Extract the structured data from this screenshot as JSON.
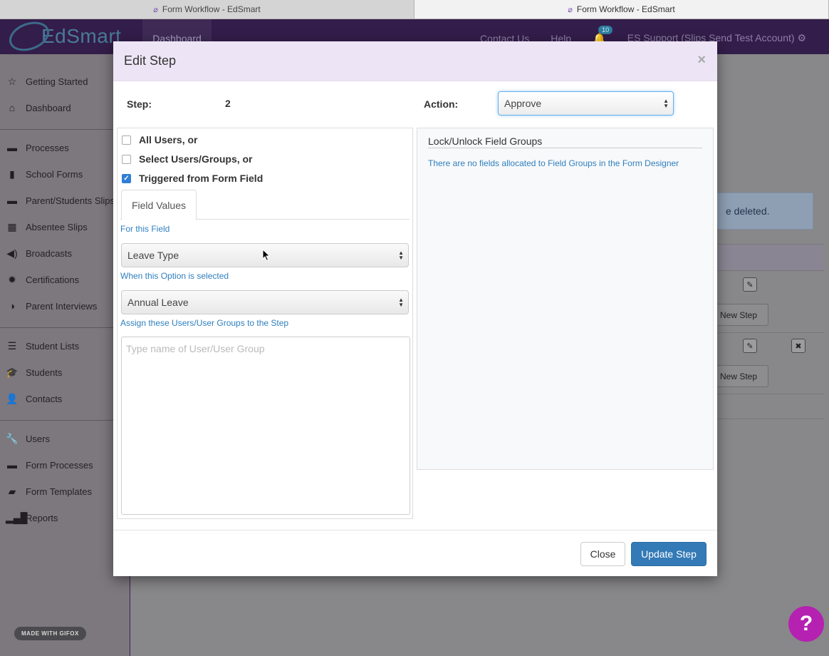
{
  "browser": {
    "tabs": [
      {
        "title": "Form Workflow - EdSmart",
        "active": false
      },
      {
        "title": "Form Workflow - EdSmart",
        "active": true
      }
    ]
  },
  "header": {
    "logo_text": "EdSmart",
    "nav_dashboard": "Dashboard",
    "contact": "Contact Us",
    "help": "Help",
    "notifications_count": "10",
    "account": "ES Support (Slips Send Test Account)"
  },
  "sidebar": {
    "items": [
      {
        "label": "Getting Started",
        "icon": "star-icon"
      },
      {
        "label": "Dashboard",
        "icon": "home-icon"
      },
      {
        "label": "Processes",
        "icon": "briefcase-icon"
      },
      {
        "label": "School Forms",
        "icon": "file-icon"
      },
      {
        "label": "Parent/Students Slips",
        "icon": "briefcase-icon"
      },
      {
        "label": "Absentee Slips",
        "icon": "calendar-icon"
      },
      {
        "label": "Broadcasts",
        "icon": "megaphone-icon"
      },
      {
        "label": "Certifications",
        "icon": "certificate-icon"
      },
      {
        "label": "Parent Interviews",
        "icon": "contrast-icon"
      },
      {
        "label": "Student Lists",
        "icon": "list-icon"
      },
      {
        "label": "Students",
        "icon": "graduation-cap-icon"
      },
      {
        "label": "Contacts",
        "icon": "user-icon"
      },
      {
        "label": "Users",
        "icon": "wrench-icon"
      },
      {
        "label": "Form Processes",
        "icon": "briefcase-icon"
      },
      {
        "label": "Form Templates",
        "icon": "folder-icon"
      },
      {
        "label": "Reports",
        "icon": "bar-chart-icon"
      }
    ]
  },
  "background": {
    "alert_fragment": "e deleted.",
    "new_step_fragment": "d New Step"
  },
  "watermark": "MADE WITH GIFOX",
  "modal": {
    "title": "Edit Step",
    "close_symbol": "×",
    "step_label": "Step:",
    "step_value": "2",
    "action_label": "Action:",
    "action_value": "Approve",
    "options": {
      "all_users": "All Users, or",
      "select_users": "Select Users/Groups, or",
      "triggered": "Triggered from Form Field"
    },
    "tab_label": "Field Values",
    "for_this_field": "For this Field",
    "field_value": "Leave Type",
    "when_option": "When this Option is selected",
    "option_value": "Annual Leave",
    "assign_label": "Assign these Users/User Groups to the Step",
    "users_placeholder": "Type name of User/User Group",
    "lock_title": "Lock/Unlock Field Groups",
    "lock_note": "There are no fields allocated to Field Groups in the Form Designer",
    "close_button": "Close",
    "update_button": "Update Step"
  }
}
